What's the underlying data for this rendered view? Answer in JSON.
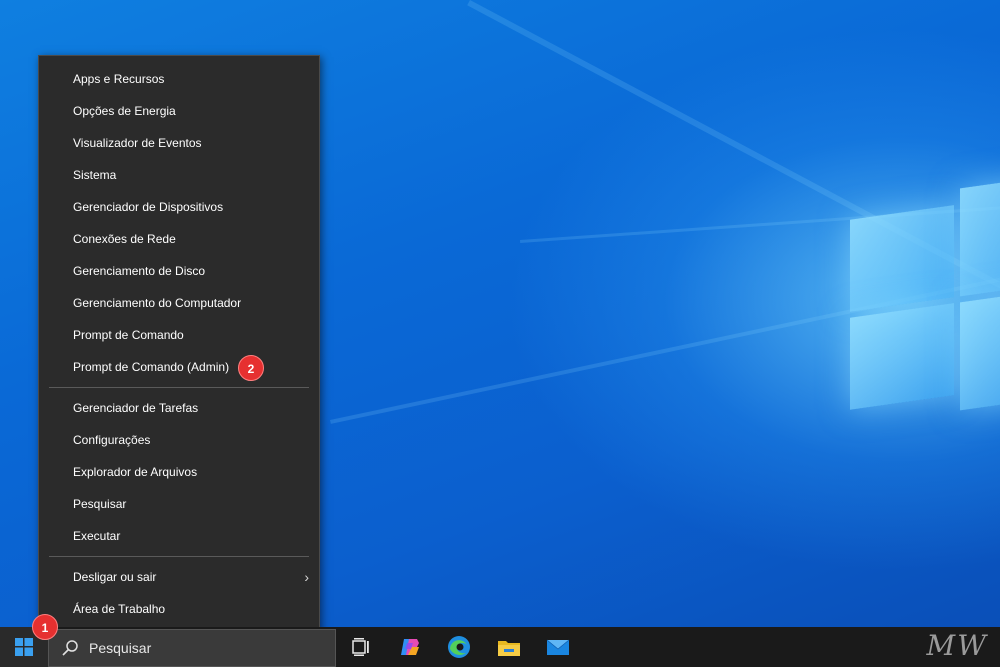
{
  "menu": {
    "group1": [
      {
        "label": "Apps e Recursos"
      },
      {
        "label": "Opções de Energia"
      },
      {
        "label": "Visualizador de Eventos"
      },
      {
        "label": "Sistema"
      },
      {
        "label": "Gerenciador de Dispositivos"
      },
      {
        "label": "Conexões de Rede"
      },
      {
        "label": "Gerenciamento de Disco"
      },
      {
        "label": "Gerenciamento do Computador"
      },
      {
        "label": "Prompt de Comando"
      },
      {
        "label": "Prompt de Comando (Admin)"
      }
    ],
    "group2": [
      {
        "label": "Gerenciador de Tarefas"
      },
      {
        "label": "Configurações"
      },
      {
        "label": "Explorador de Arquivos"
      },
      {
        "label": "Pesquisar"
      },
      {
        "label": "Executar"
      }
    ],
    "group3": [
      {
        "label": "Desligar ou sair"
      },
      {
        "label": "Área de Trabalho"
      }
    ]
  },
  "badges": {
    "step1": "1",
    "step2": "2"
  },
  "taskbar": {
    "search_placeholder": "Pesquisar",
    "icons": [
      "task-view-icon",
      "copilot-icon",
      "edge-icon",
      "file-explorer-icon",
      "mail-icon"
    ]
  },
  "watermark": "MW",
  "colors": {
    "accent_badge": "#e63030",
    "menu_bg": "#2b2b2b",
    "taskbar_bg": "#1a1a1a",
    "desktop_blue": "#0a69d6"
  }
}
